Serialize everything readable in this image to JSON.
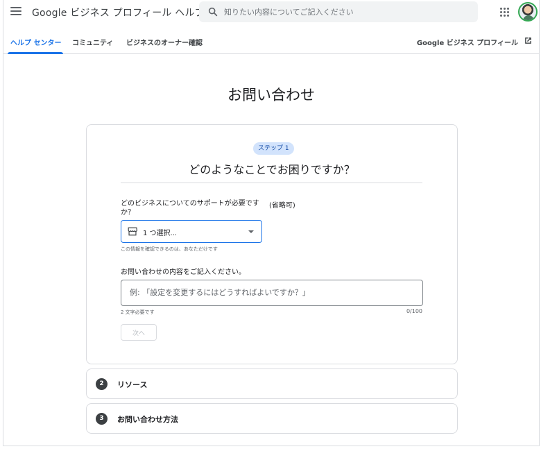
{
  "header": {
    "app_title": "Google ビジネス プロフィール ヘルプ",
    "search_placeholder": "知りたい内容についてご記入ください",
    "menu_icon": "hamburger-menu-icon",
    "apps_icon": "google-apps-icon",
    "avatar": "account-avatar"
  },
  "tabs": [
    {
      "label": "ヘルプ センター",
      "active": true
    },
    {
      "label": "コミュニティ",
      "active": false
    },
    {
      "label": "ビジネスのオーナー確認",
      "active": false
    }
  ],
  "product_link": {
    "label": "Google ビジネス プロフィール",
    "icon": "open-in-new-icon"
  },
  "page": {
    "title": "お問い合わせ"
  },
  "step1": {
    "chip": "ステップ 1",
    "question": "どのようなことでお困りですか？",
    "business_label": "どのビジネスについてのサポートが必要ですか？",
    "optional_label": "(省略可)",
    "select_value": "1 つ選択...",
    "select_icon": "storefront-icon",
    "hint": "この情報を確認できるのは、あなただけです",
    "description_label": "お問い合わせの内容をご記入ください。",
    "description_placeholder": "例: 「設定を変更するにはどうすればよいですか？」",
    "min_chars": "2 文字必要です",
    "counter": "0/100",
    "next_label": "次へ"
  },
  "steps": [
    {
      "number": "2",
      "title": "リソース"
    },
    {
      "number": "3",
      "title": "お問い合わせ方法"
    }
  ],
  "colors": {
    "accent": "#1a73e8",
    "chip_bg": "#d2e3fc",
    "border": "#dadce0",
    "step_badge": "#3c4043"
  }
}
